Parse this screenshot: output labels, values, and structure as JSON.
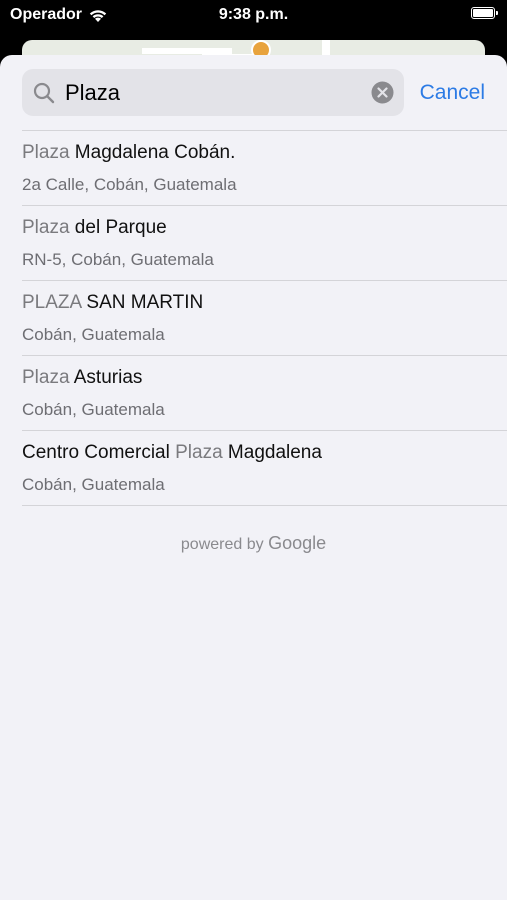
{
  "status_bar": {
    "carrier": "Operador",
    "time": "9:38 p.m."
  },
  "search": {
    "query": "Plaza",
    "cancel_label": "Cancel"
  },
  "results": [
    {
      "pre": "",
      "match": "Plaza",
      "post": " Magdalena Cobán.",
      "subtitle": "2a Calle, Cobán, Guatemala"
    },
    {
      "pre": "",
      "match": "Plaza",
      "post": " del Parque",
      "subtitle": "RN-5, Cobán, Guatemala"
    },
    {
      "pre": "",
      "match": "PLAZA",
      "post": " SAN MARTIN",
      "subtitle": "Cobán, Guatemala"
    },
    {
      "pre": "",
      "match": "Plaza",
      "post": " Asturias",
      "subtitle": "Cobán, Guatemala"
    },
    {
      "pre": "Centro Comercial ",
      "match": "Plaza",
      "post": " Magdalena",
      "subtitle": "Cobán, Guatemala"
    }
  ],
  "attribution": {
    "prefix": "powered by",
    "brand": "Google"
  },
  "icons": {
    "wifi": "wifi-icon",
    "battery": "battery-icon",
    "search": "search-icon",
    "clear": "clear-icon",
    "map_pin": "map-pin-icon"
  },
  "colors": {
    "accent": "#2c7be5",
    "sheet_bg": "#f2f2f7",
    "field_bg": "#e3e3e8"
  }
}
